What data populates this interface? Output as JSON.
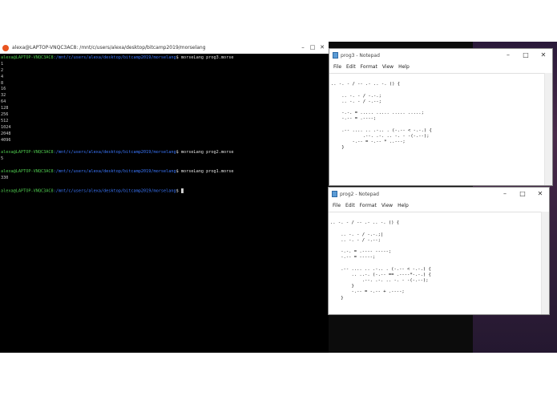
{
  "terminal": {
    "title": "alexa@LAPTOP-VNQC3AC8: /mnt/c/users/alexa/desktop/bitcamp2019/morselang",
    "controls": [
      "–",
      "□",
      "✕"
    ],
    "lines": [
      {
        "kind": "prompt",
        "user": "alexa@LAPTOP-VNQC3AC8",
        "path": ":/mnt/c/users/alexa/desktop/bitcamp2019/morselang",
        "cmd": "$ morseLang prog3.morse"
      },
      {
        "kind": "out",
        "text": "1"
      },
      {
        "kind": "out",
        "text": "2"
      },
      {
        "kind": "out",
        "text": "4"
      },
      {
        "kind": "out",
        "text": "8"
      },
      {
        "kind": "out",
        "text": "16"
      },
      {
        "kind": "out",
        "text": "32"
      },
      {
        "kind": "out",
        "text": "64"
      },
      {
        "kind": "out",
        "text": "128"
      },
      {
        "kind": "out",
        "text": "256"
      },
      {
        "kind": "out",
        "text": "512"
      },
      {
        "kind": "out",
        "text": "1024"
      },
      {
        "kind": "out",
        "text": "2048"
      },
      {
        "kind": "out",
        "text": "4096"
      },
      {
        "kind": "out",
        "text": ""
      },
      {
        "kind": "prompt",
        "user": "alexa@LAPTOP-VNQC3AC8",
        "path": ":/mnt/c/users/alexa/desktop/bitcamp2019/morselang",
        "cmd": "$ morseLang prog2.morse"
      },
      {
        "kind": "out",
        "text": "5"
      },
      {
        "kind": "out",
        "text": ""
      },
      {
        "kind": "prompt",
        "user": "alexa@LAPTOP-VNQC3AC8",
        "path": ":/mnt/c/users/alexa/desktop/bitcamp2019/morselang",
        "cmd": "$ morseLang prog1.morse"
      },
      {
        "kind": "out",
        "text": "330"
      },
      {
        "kind": "out",
        "text": ""
      },
      {
        "kind": "prompt",
        "user": "alexa@LAPTOP-VNQC3AC8",
        "path": ":/mnt/c/users/alexa/desktop/bitcamp2019/morselang",
        "cmd": "$ ",
        "cursor": true
      }
    ]
  },
  "notepad1": {
    "title": "prog3 - Notepad",
    "controls": [
      "–",
      "□",
      "✕"
    ],
    "menu": [
      "File",
      "Edit",
      "Format",
      "View",
      "Help"
    ],
    "lines": [
      "",
      ".. -. - / -- .- .. -. () {",
      "",
      "    .. -. - / -.-.;",
      "    .. -. - / -.--;",
      "",
      "    -.-. = ..... ..... ..... .....;",
      "    -.-- = .----;",
      "",
      "    .-- .... .. .-.. . (-.-- < -.-.) {",
      "            .--. .-. .. -. - -(-.--);",
      "        -.-- = -.-- * ..---;",
      "    }"
    ]
  },
  "notepad2": {
    "title": "prog2 - Notepad",
    "controls": [
      "–",
      "□",
      "✕"
    ],
    "menu": [
      "File",
      "Edit",
      "Format",
      "View",
      "Help"
    ],
    "lines": [
      "",
      ".. -. - / -- .- .. -. () {",
      "",
      "    .. -. - / -.-.;|",
      "    .. -. - / -.--;",
      "",
      "    -.-. = .---- -----;",
      "    -.-- = -----;",
      "",
      "    .-- .... .. .-.. . (-.-- < -.-.) {",
      "        .. ..-. (-.-- == .----*-.-.) {",
      "            .--. .-. .. -. - -(-.--);",
      "        }",
      "        -.-- = -.-- + .----;",
      "    }"
    ]
  }
}
